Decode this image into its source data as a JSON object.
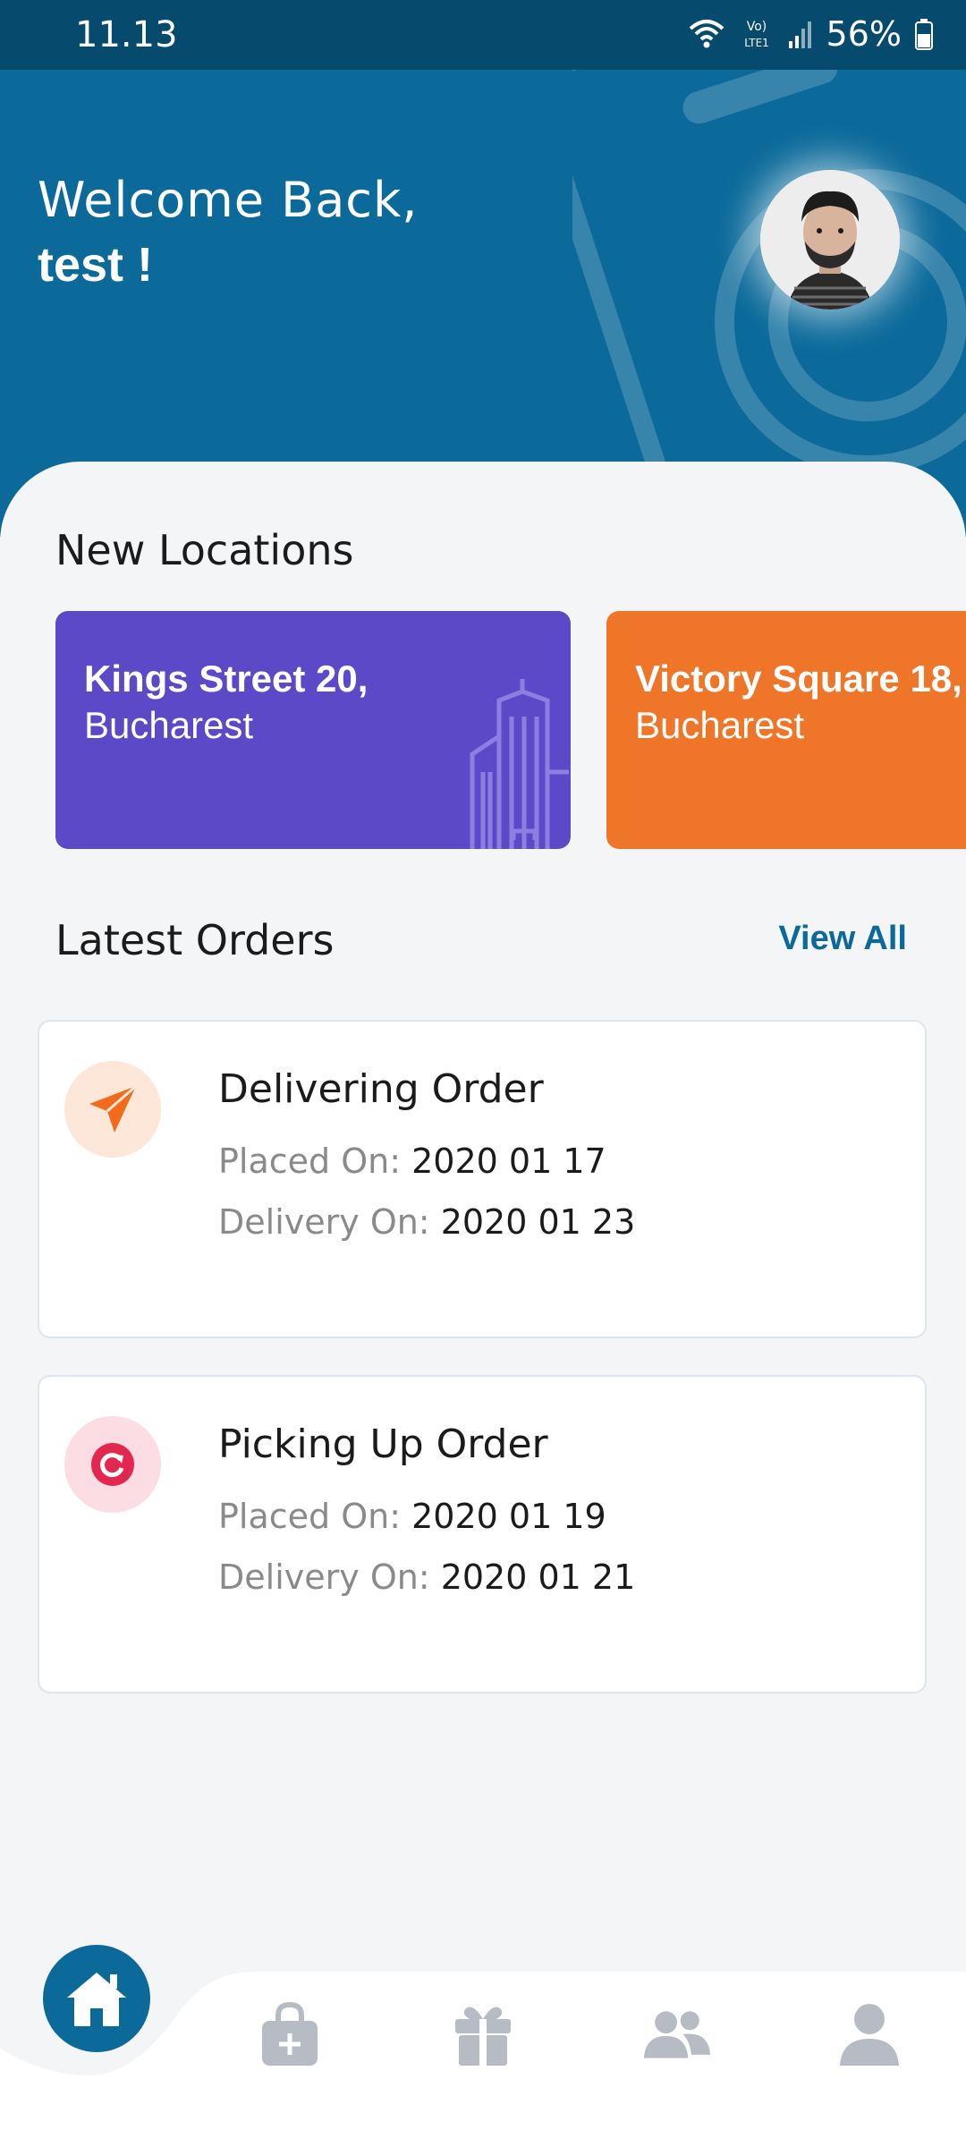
{
  "status_bar": {
    "time": "11.13",
    "network": "Vo) LTE1",
    "battery": "56%"
  },
  "header": {
    "greeting": "Welcome Back,",
    "username": "test !"
  },
  "new_locations": {
    "title": "New Locations",
    "cards": [
      {
        "street": "Kings Street 20,",
        "city": "Bucharest",
        "color": "#5b49c8"
      },
      {
        "street": "Victory Square 18,",
        "city": "Bucharest",
        "color": "#ef7629"
      }
    ]
  },
  "latest_orders": {
    "title": "Latest Orders",
    "view_all": "View All",
    "orders": [
      {
        "title": "Delivering Order",
        "placed_label": "Placed On:",
        "placed_value": "2020 01 17",
        "delivery_label": "Delivery On:",
        "delivery_value": "2020 01 23",
        "icon": "send-icon",
        "icon_color": "#f26b1d",
        "icon_bg": "#fde7d9"
      },
      {
        "title": "Picking Up Order",
        "placed_label": "Placed On:",
        "placed_value": "2020 01 19",
        "delivery_label": "Delivery On:",
        "delivery_value": "2020 01 21",
        "icon": "refresh-icon",
        "icon_color": "#e3284f",
        "icon_bg": "#fbdde3"
      }
    ]
  },
  "bottom_nav": {
    "items": [
      "home-icon",
      "shopping-bag-icon",
      "gift-icon",
      "group-icon",
      "profile-icon"
    ],
    "active": "home-icon",
    "active_color": "#0b6a9a",
    "inactive_color": "#b7bcc4"
  }
}
